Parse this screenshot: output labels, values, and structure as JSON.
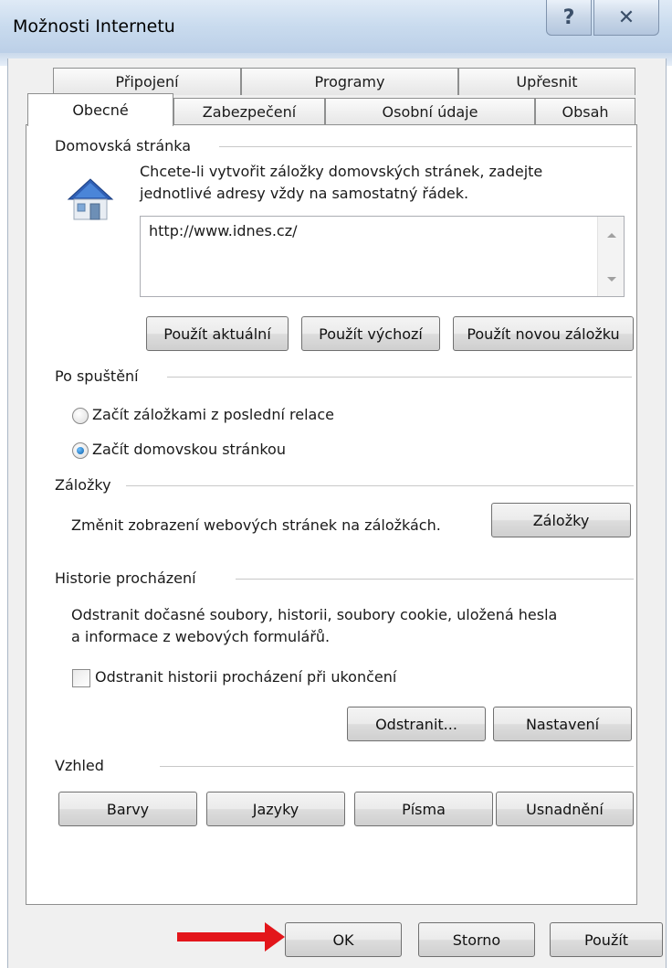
{
  "window": {
    "title": "Možnosti Internetu"
  },
  "tabs": {
    "row_back": [
      "Připojení",
      "Programy",
      "Upřesnit"
    ],
    "row_front": [
      "Obecné",
      "Zabezpečení",
      "Osobní údaje",
      "Obsah"
    ],
    "active": "Obecné"
  },
  "homepage": {
    "section_label": "Domovská stránka",
    "description_line1": "Chcete-li vytvořit záložky domovských stránek, zadejte",
    "description_line2": "jednotlivé adresy vždy na samostatný řádek.",
    "value": "http://www.idnes.cz/",
    "icon": "house-icon",
    "buttons": [
      "Použít aktuální",
      "Použít výchozí",
      "Použít novou záložku"
    ]
  },
  "startup": {
    "section_label": "Po spuštění",
    "options": [
      "Začít záložkami z poslední relace",
      "Začít domovskou stránkou"
    ],
    "selected_index": 1
  },
  "tabs_section": {
    "section_label": "Záložky",
    "description": "Změnit zobrazení webových stránek na záložkách.",
    "button": "Záložky"
  },
  "history": {
    "section_label": "Historie procházení",
    "description_line1": "Odstranit dočasné soubory, historii, soubory cookie, uložená hesla",
    "description_line2": "a informace z webových formulářů.",
    "checkbox_label": "Odstranit historii procházení při ukončení",
    "checkbox_checked": false,
    "buttons": [
      "Odstranit...",
      "Nastavení"
    ]
  },
  "appearance": {
    "section_label": "Vzhled",
    "buttons": [
      "Barvy",
      "Jazyky",
      "Písma",
      "Usnadnění"
    ]
  },
  "footer": {
    "buttons": [
      "OK",
      "Storno",
      "Použít"
    ]
  },
  "colors": {
    "accent_arrow": "#e3161b",
    "radio_selected": "#0a5fa8"
  }
}
